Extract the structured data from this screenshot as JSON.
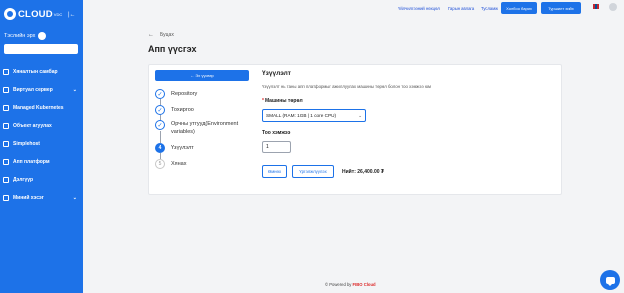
{
  "sidebar": {
    "logo_text": "CLOUD",
    "logo_sup": "VDC",
    "balance_label": "Тэслийн эрх",
    "items": [
      {
        "label": "Хяналтын самбар",
        "chevron": false,
        "icon": "dashboard-icon"
      },
      {
        "label": "Виртуал сервер",
        "chevron": true,
        "icon": "server-icon"
      },
      {
        "label": "Managed Kubernetes",
        "chevron": false,
        "icon": "kubernetes-icon"
      },
      {
        "label": "Объект агуулах",
        "chevron": false,
        "icon": "storage-icon"
      },
      {
        "label": "Simplehost",
        "chevron": false,
        "icon": "host-icon"
      },
      {
        "label": "Апп платформ",
        "chevron": false,
        "icon": "app-platform-icon"
      },
      {
        "label": "Дэлгүүр",
        "chevron": false,
        "icon": "store-icon"
      },
      {
        "label": "Миний хэсэг",
        "chevron": true,
        "icon": "user-icon"
      }
    ]
  },
  "topbar": {
    "link1": "Үйлчилгээний нөхцөл",
    "link2": "Гарын авлага",
    "link3": "Тусламж",
    "btn1": "Холбоо барих",
    "btn2": "Туршилт хийх"
  },
  "page": {
    "back_label": "Буцах",
    "title": "Апп үүсгэх"
  },
  "steps": {
    "back_button": "← Эх үүсвэр",
    "items": [
      {
        "label": "Repository",
        "state": "done",
        "mark": "✓"
      },
      {
        "label": "Тохиргоо",
        "state": "done",
        "mark": "✓"
      },
      {
        "label": "Орчны утгууд(Environment variables)",
        "state": "done",
        "mark": "✓"
      },
      {
        "label": "Үзүүлэлт",
        "state": "active",
        "mark": "4"
      },
      {
        "label": "Хянах",
        "state": "pending",
        "mark": "5"
      }
    ]
  },
  "form": {
    "title": "Үзүүлэлт",
    "description": "Үзүүлэлт нь таны апп платформыг ажиллуулах машины төрөл болон тоо хэмжээ юм",
    "machine_label": "Машины төрөл",
    "machine_value": "SMALL (RAM: 1GB | 1 core CPU)",
    "count_label": "Тоо хэмжээ",
    "count_value": "1",
    "back_button": "Өмнөх",
    "continue_button": "Үргэлжлүүлэх",
    "price": "Нийт: 26,400.00 ₮"
  },
  "footer": {
    "prefix": "© Powered by",
    "brand": "FIBO Cloud"
  },
  "colors": {
    "accent": "#1d72e8",
    "required": "#dc2626"
  }
}
